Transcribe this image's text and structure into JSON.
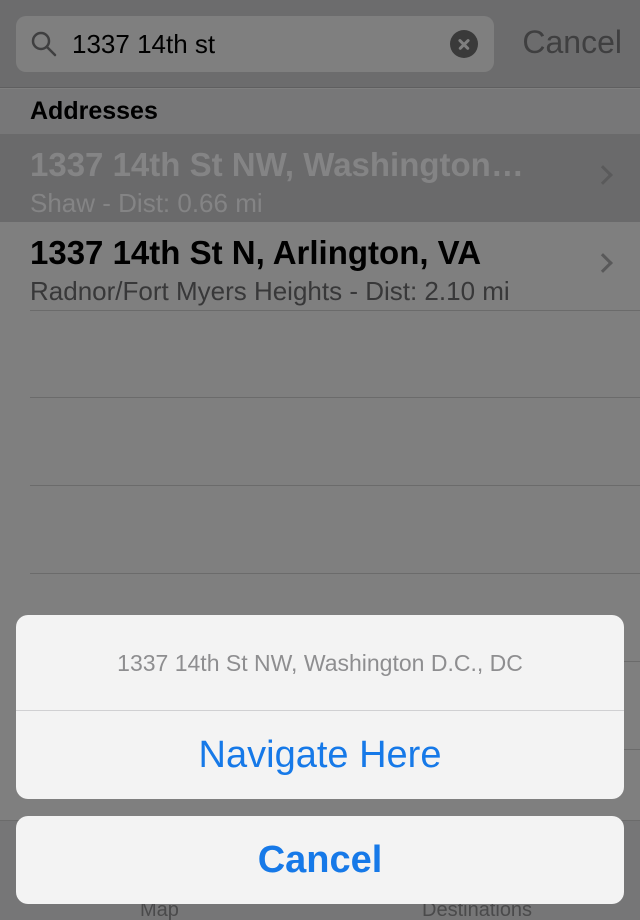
{
  "search": {
    "query": "1337 14th st",
    "cancel_label": "Cancel"
  },
  "results": {
    "section_title": "Addresses",
    "items": [
      {
        "title": "1337 14th St NW, Washington…",
        "subtitle": "Shaw - Dist: 0.66 mi",
        "selected": true
      },
      {
        "title": "1337 14th St N, Arlington, VA",
        "subtitle": "Radnor/Fort Myers Heights - Dist: 2.10 mi",
        "selected": false
      }
    ]
  },
  "tabbar": {
    "tabs": [
      {
        "label": "Map"
      },
      {
        "label": "Destinations"
      }
    ]
  },
  "action_sheet": {
    "title": "1337 14th St NW, Washington D.C., DC",
    "action_label": "Navigate Here",
    "cancel_label": "Cancel"
  },
  "colors": {
    "accent": "#1679e8",
    "overlay_dim": "#7f7f7f",
    "sheet_bg": "#f3f3f3"
  }
}
